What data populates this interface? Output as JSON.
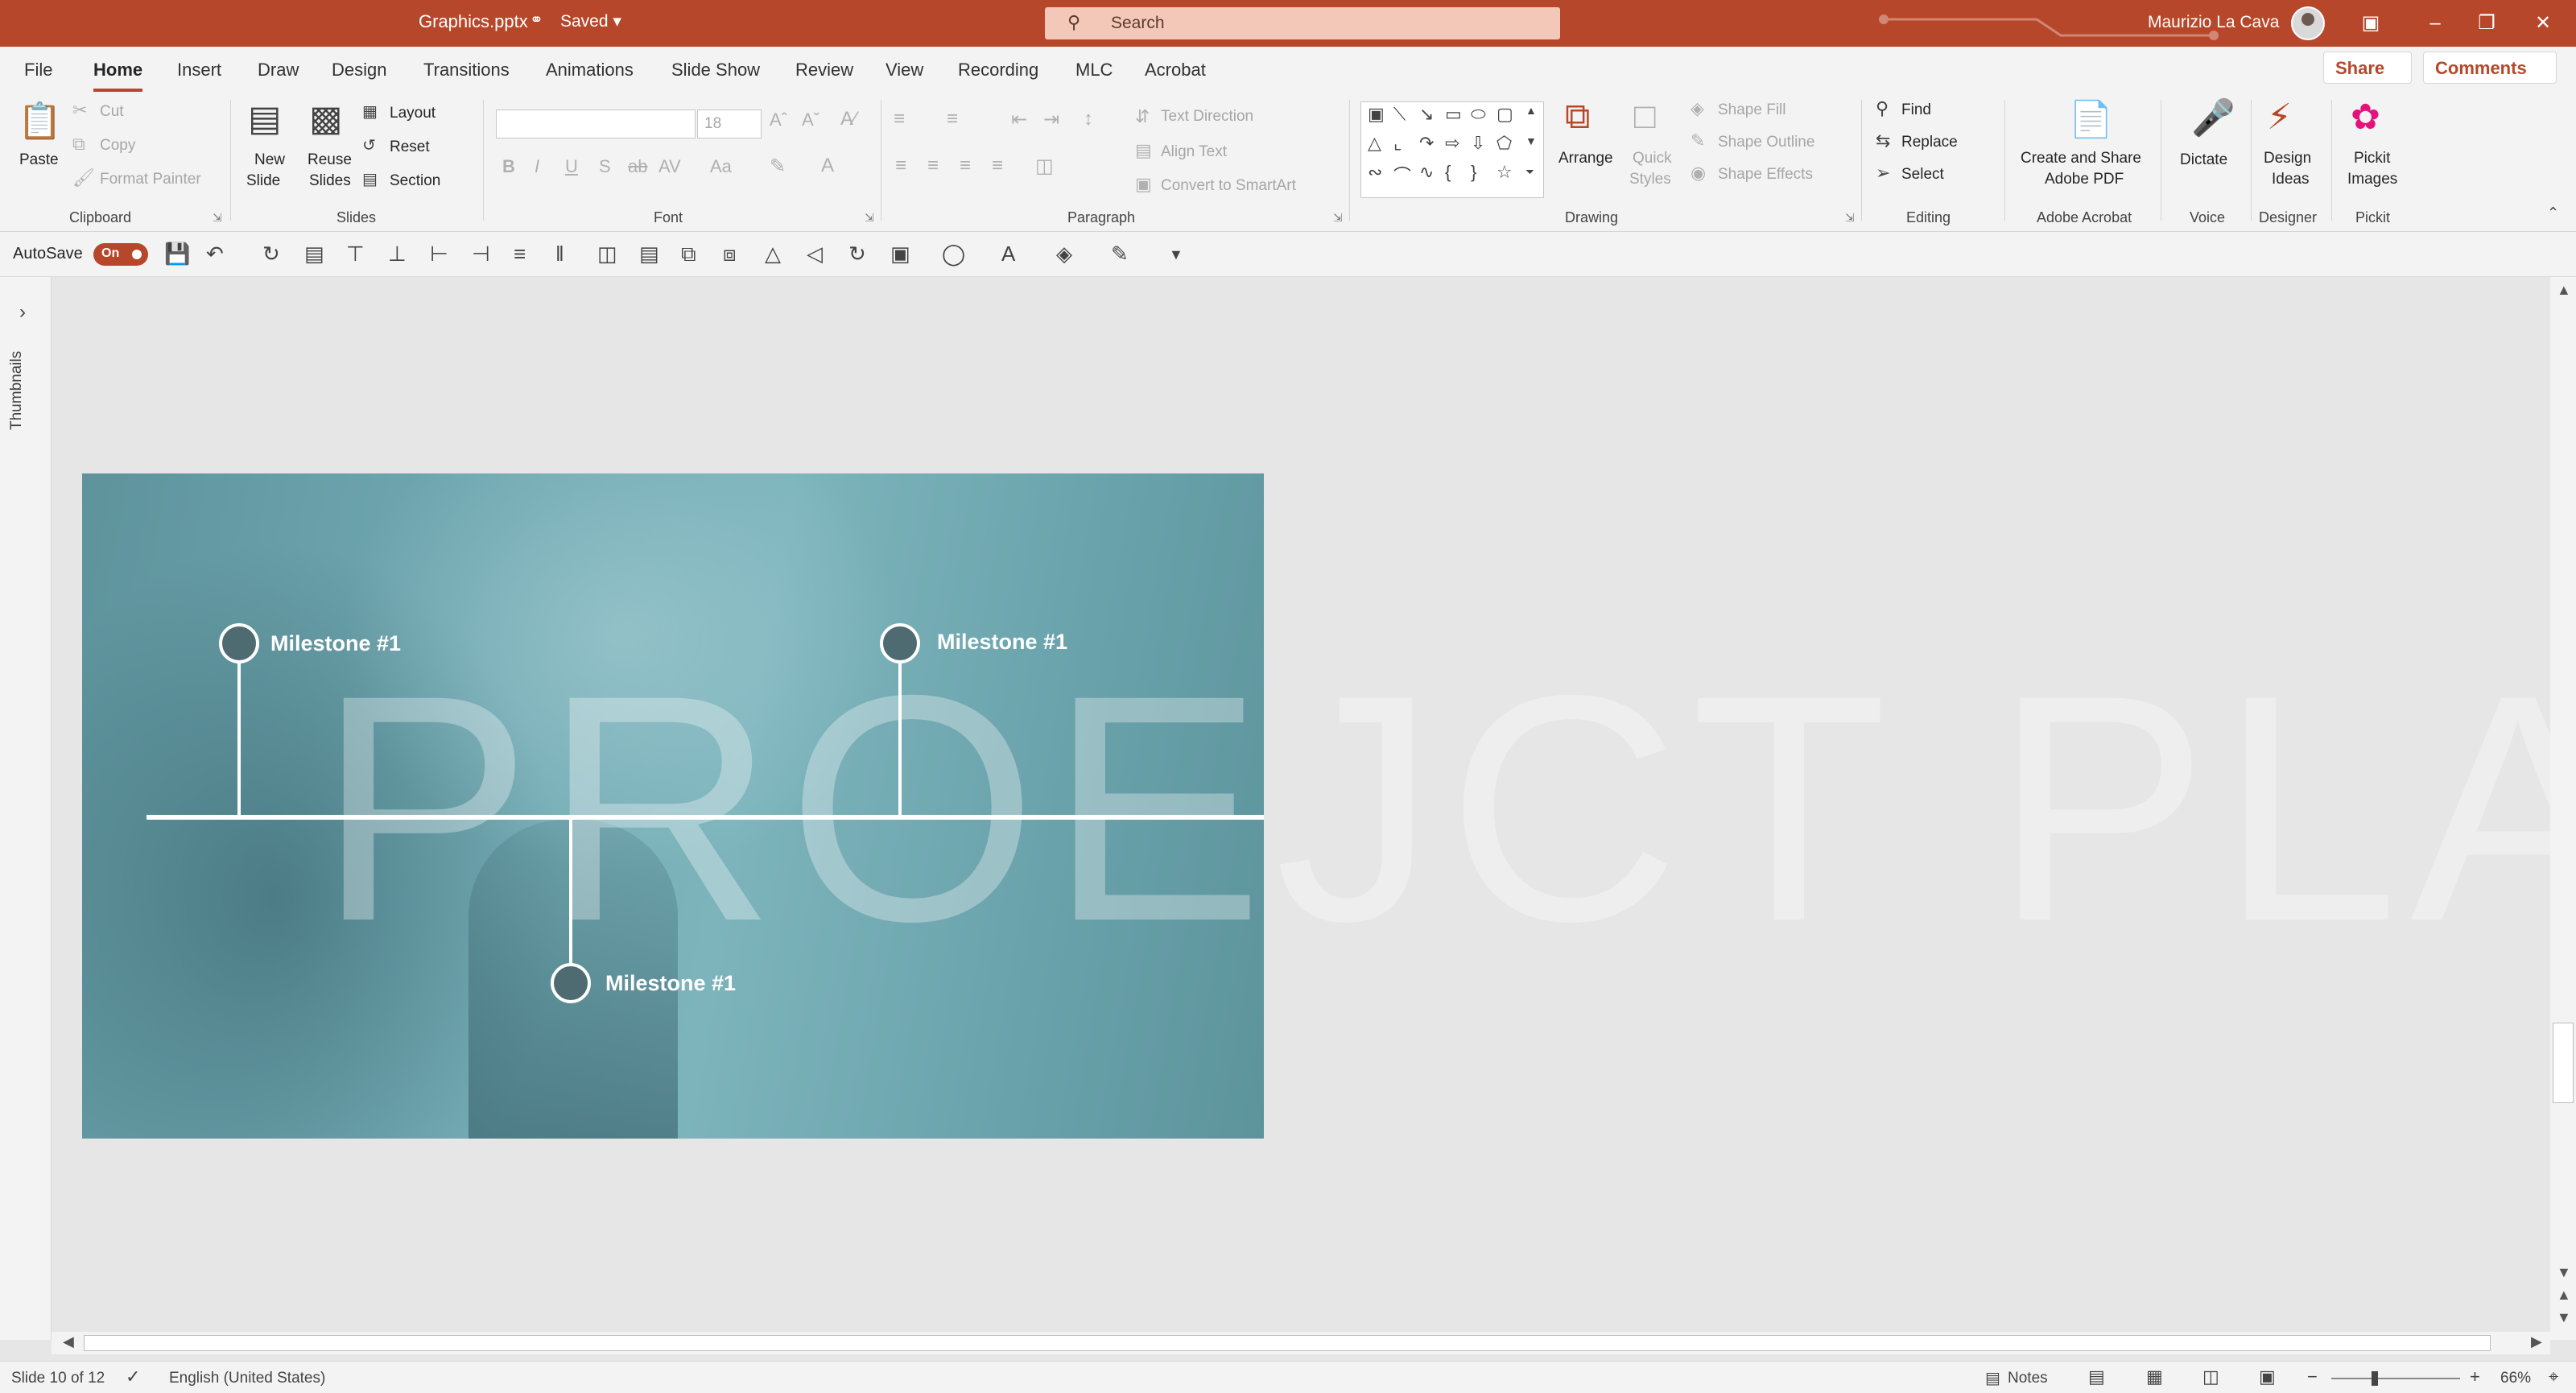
{
  "titlebar": {
    "filename": "Graphics.pptx",
    "saved": "Saved",
    "search_placeholder": "Search",
    "user_name": "Maurizio La Cava"
  },
  "tabs": [
    "File",
    "Home",
    "Insert",
    "Draw",
    "Design",
    "Transitions",
    "Animations",
    "Slide Show",
    "Review",
    "View",
    "Recording",
    "MLC",
    "Acrobat"
  ],
  "share_label": "Share",
  "comments_label": "Comments",
  "ribbon": {
    "clipboard": {
      "paste": "Paste",
      "cut": "Cut",
      "copy": "Copy",
      "format_painter": "Format Painter",
      "group": "Clipboard"
    },
    "slides": {
      "new_slide_1": "New",
      "new_slide_2": "Slide",
      "reuse_1": "Reuse",
      "reuse_2": "Slides",
      "layout": "Layout",
      "reset": "Reset",
      "section": "Section",
      "group": "Slides"
    },
    "font": {
      "size": "18",
      "group": "Font"
    },
    "paragraph": {
      "text_direction": "Text Direction",
      "align_text": "Align Text",
      "convert_smartart": "Convert to SmartArt",
      "group": "Paragraph"
    },
    "drawing": {
      "arrange": "Arrange",
      "quick_styles_1": "Quick",
      "quick_styles_2": "Styles",
      "shape_fill": "Shape Fill",
      "shape_outline": "Shape Outline",
      "shape_effects": "Shape Effects",
      "group": "Drawing"
    },
    "editing": {
      "find": "Find",
      "replace": "Replace",
      "select": "Select",
      "group": "Editing"
    },
    "acrobat": {
      "create_1": "Create and Share",
      "create_2": "Adobe PDF",
      "group": "Adobe Acrobat"
    },
    "voice": {
      "dictate": "Dictate",
      "group": "Voice"
    },
    "designer": {
      "ideas_1": "Design",
      "ideas_2": "Ideas",
      "group": "Designer"
    },
    "pickit": {
      "images_1": "Pickit",
      "images_2": "Images",
      "group": "Pickit"
    }
  },
  "qat": {
    "autosave": "AutoSave",
    "toggle": "On"
  },
  "thumbnails_label": "Thumbnails",
  "slide": {
    "background_word": "PROEJCT PLAN",
    "milestones": [
      {
        "label": "Milestone #1"
      },
      {
        "label": "Milestone #1"
      },
      {
        "label": "Milestone #1"
      }
    ]
  },
  "status": {
    "slide_counter": "Slide 10 of 12",
    "language": "English (United States)",
    "notes": "Notes",
    "zoom": "66%"
  },
  "colors": {
    "accent": "#b7472a",
    "slide_teal": "#6fa7b0",
    "node": "#4f6b72"
  }
}
